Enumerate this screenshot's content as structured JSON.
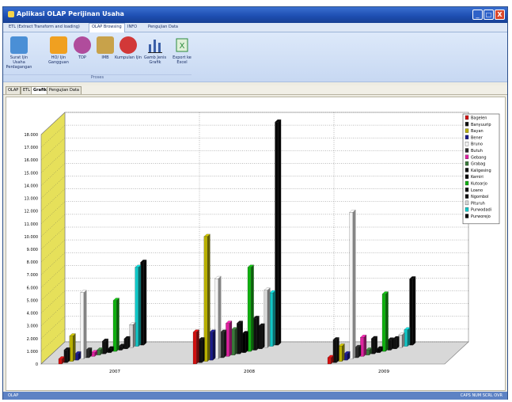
{
  "window": {
    "title": "Aplikasi OLAP Perijinan Usaha",
    "buttons": {
      "minimize": "_",
      "maximize": "□",
      "close": "X"
    }
  },
  "menu_tabs": [
    {
      "label": "ETL (Extract Transform and loading)",
      "active": false
    },
    {
      "label": "OLAP Browsing",
      "active": true
    },
    {
      "label": "INFO",
      "active": false
    },
    {
      "label": "Pengujian Data",
      "active": false
    }
  ],
  "ribbon": {
    "buttons": [
      {
        "label": "Surat Ijin Usaha Perdagangan",
        "icon": "siup-icon",
        "color": "#4a8fd6"
      },
      {
        "label": "HO/ Ijin Gangguan",
        "icon": "ho-icon",
        "color": "#f0a020"
      },
      {
        "label": "TDP",
        "icon": "tdp-icon",
        "color": "#b04c9c"
      },
      {
        "label": "IMB",
        "icon": "imb-icon",
        "color": "#c8a24a"
      },
      {
        "label": "Kumpulan Ijin",
        "icon": "kumpulan-ijin-icon",
        "color": "#d23838"
      },
      {
        "label": "Gamb Jenis Grafik",
        "icon": "chart-type-icon",
        "color": "#3a5fa8"
      },
      {
        "label": "Export ke Excel",
        "icon": "excel-icon",
        "color": "#2b8a3e"
      }
    ],
    "group_label": "Proses"
  },
  "view_tabs": [
    {
      "label": "OLAP",
      "active": false
    },
    {
      "label": "ETL",
      "active": false
    },
    {
      "label": "Grafik",
      "active": true
    },
    {
      "label": "Pengujian Data",
      "active": false
    }
  ],
  "status": {
    "left": "OLAP",
    "right": "CAPS  NUM  SCRL  OVR"
  },
  "chart_data": {
    "type": "bar",
    "style": "3d-clustered",
    "categories": [
      "2007",
      "2008",
      "2009"
    ],
    "ylim": [
      0,
      18000
    ],
    "yticks": [
      "0",
      "1.000",
      "2.000",
      "3.000",
      "4.000",
      "5.000",
      "6.000",
      "7.000",
      "8.000",
      "9.000",
      "10.000",
      "11.000",
      "12.000",
      "13.000",
      "14.000",
      "15.000",
      "16.000",
      "17.000",
      "18.000"
    ],
    "legend_position": "right",
    "grid": true,
    "series": [
      {
        "name": "Bagelen",
        "color": "#d01010",
        "values": [
          400,
          2500,
          500
        ]
      },
      {
        "name": "Banyuurip",
        "color": "#101010",
        "values": [
          1000,
          1800,
          1800
        ]
      },
      {
        "name": "Bayan",
        "color": "#b8b000",
        "values": [
          2000,
          9800,
          1200
        ]
      },
      {
        "name": "Bener",
        "color": "#1a1a8a",
        "values": [
          500,
          2200,
          500
        ]
      },
      {
        "name": "Bruno",
        "color": "#f4f4f4",
        "values": [
          5200,
          6300,
          11500
        ]
      },
      {
        "name": "Butuh",
        "color": "#282828",
        "values": [
          600,
          2000,
          800
        ]
      },
      {
        "name": "Gebang",
        "color": "#e020a0",
        "values": [
          300,
          2600,
          1500
        ]
      },
      {
        "name": "Grabag",
        "color": "#3a7a3a",
        "values": [
          400,
          2000,
          400
        ]
      },
      {
        "name": "Kaligesing",
        "color": "#101010",
        "values": [
          1000,
          2400,
          1200
        ]
      },
      {
        "name": "Kemiri",
        "color": "#000000",
        "values": [
          300,
          1500,
          300
        ]
      },
      {
        "name": "Kutoarjo",
        "color": "#10b010",
        "values": [
          4000,
          6600,
          4500
        ]
      },
      {
        "name": "Loano",
        "color": "#101010",
        "values": [
          300,
          2500,
          800
        ]
      },
      {
        "name": "Ngombol",
        "color": "#101010",
        "values": [
          800,
          1800,
          800
        ]
      },
      {
        "name": "Pituruh",
        "color": "#d8d8d8",
        "values": [
          1800,
          4500,
          1000
        ]
      },
      {
        "name": "Purwodadi",
        "color": "#10c8c8",
        "values": [
          6200,
          4200,
          1300
        ]
      },
      {
        "name": "Purworejo",
        "color": "#080808",
        "values": [
          6500,
          17500,
          5200
        ]
      }
    ]
  }
}
